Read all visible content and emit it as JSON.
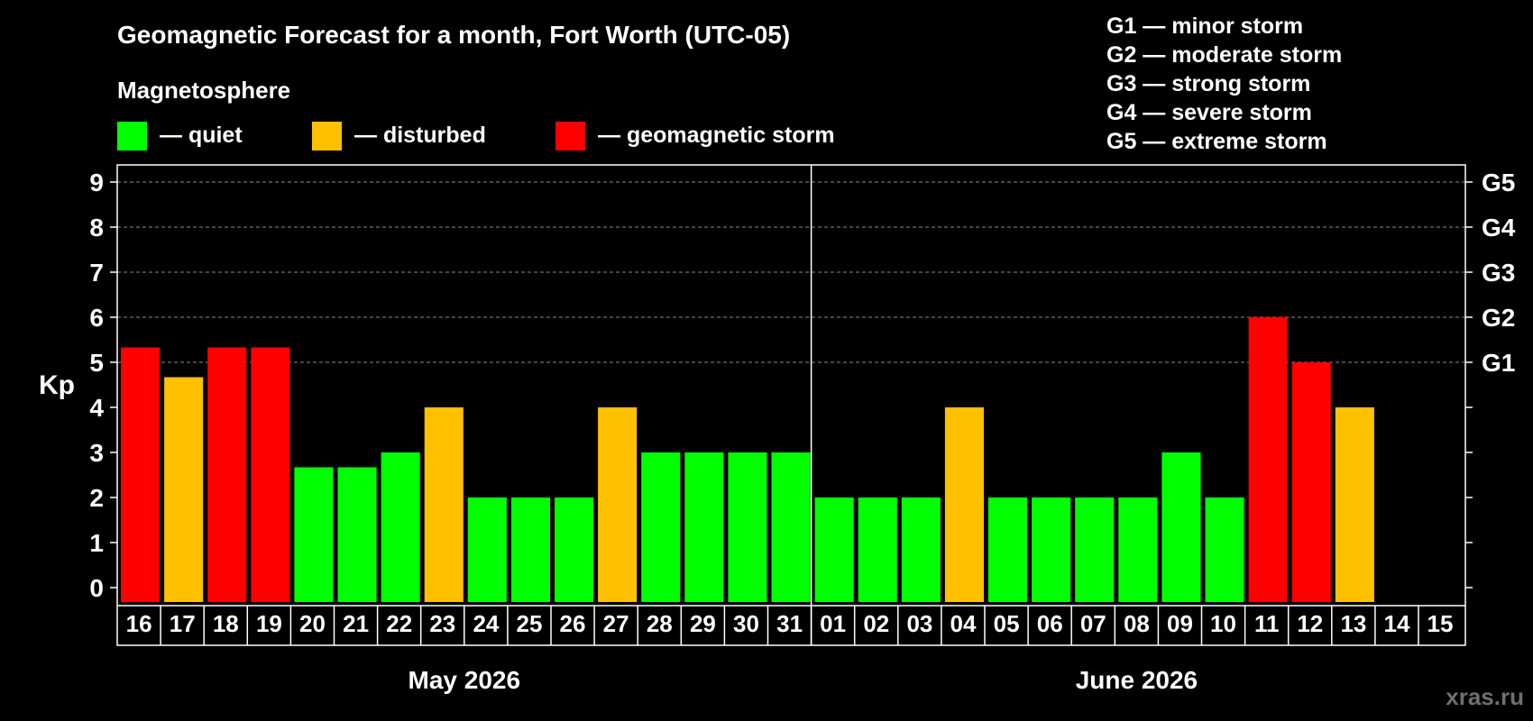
{
  "chart_data": {
    "type": "bar",
    "title": "Geomagnetic Forecast for a month, Fort Worth (UTC-05)",
    "legend_title": "Magnetosphere",
    "legend": [
      {
        "key": "quiet",
        "label": "— quiet",
        "color": "#00ff00"
      },
      {
        "key": "disturbed",
        "label": "— disturbed",
        "color": "#ffc000"
      },
      {
        "key": "storm",
        "label": "— geomagnetic storm",
        "color": "#ff0000"
      }
    ],
    "storm_scale": [
      "G1 — minor storm",
      "G2 — moderate storm",
      "G3 — strong storm",
      "G4 — severe storm",
      "G5 — extreme storm"
    ],
    "ylabel": "Kp",
    "ylim": [
      0,
      9
    ],
    "yticks": [
      0,
      1,
      2,
      3,
      4,
      5,
      6,
      7,
      8,
      9
    ],
    "right_axis_labels": [
      {
        "kp": 5,
        "label": "G1"
      },
      {
        "kp": 6,
        "label": "G2"
      },
      {
        "kp": 7,
        "label": "G3"
      },
      {
        "kp": 8,
        "label": "G4"
      },
      {
        "kp": 9,
        "label": "G5"
      }
    ],
    "grid": "dashed horizontal at Kp 5-9",
    "categories": [
      "16",
      "17",
      "18",
      "19",
      "20",
      "21",
      "22",
      "23",
      "24",
      "25",
      "26",
      "27",
      "28",
      "29",
      "30",
      "31",
      "01",
      "02",
      "03",
      "04",
      "05",
      "06",
      "07",
      "08",
      "09",
      "10",
      "11",
      "12",
      "13",
      "14",
      "15"
    ],
    "values": [
      5.33,
      4.67,
      5.33,
      5.33,
      2.67,
      2.67,
      3,
      4,
      2,
      2,
      2,
      4,
      3,
      3,
      3,
      3,
      2,
      2,
      2,
      4,
      2,
      2,
      2,
      2,
      3,
      2,
      6,
      5,
      4,
      null,
      null
    ],
    "status": [
      "storm",
      "disturbed",
      "storm",
      "storm",
      "quiet",
      "quiet",
      "quiet",
      "disturbed",
      "quiet",
      "quiet",
      "quiet",
      "disturbed",
      "quiet",
      "quiet",
      "quiet",
      "quiet",
      "quiet",
      "quiet",
      "quiet",
      "disturbed",
      "quiet",
      "quiet",
      "quiet",
      "quiet",
      "quiet",
      "quiet",
      "storm",
      "storm",
      "disturbed",
      null,
      null
    ],
    "months": [
      {
        "label": "May 2026",
        "count": 16
      },
      {
        "label": "June 2026",
        "count": 15
      }
    ]
  },
  "watermark": "xras.ru"
}
